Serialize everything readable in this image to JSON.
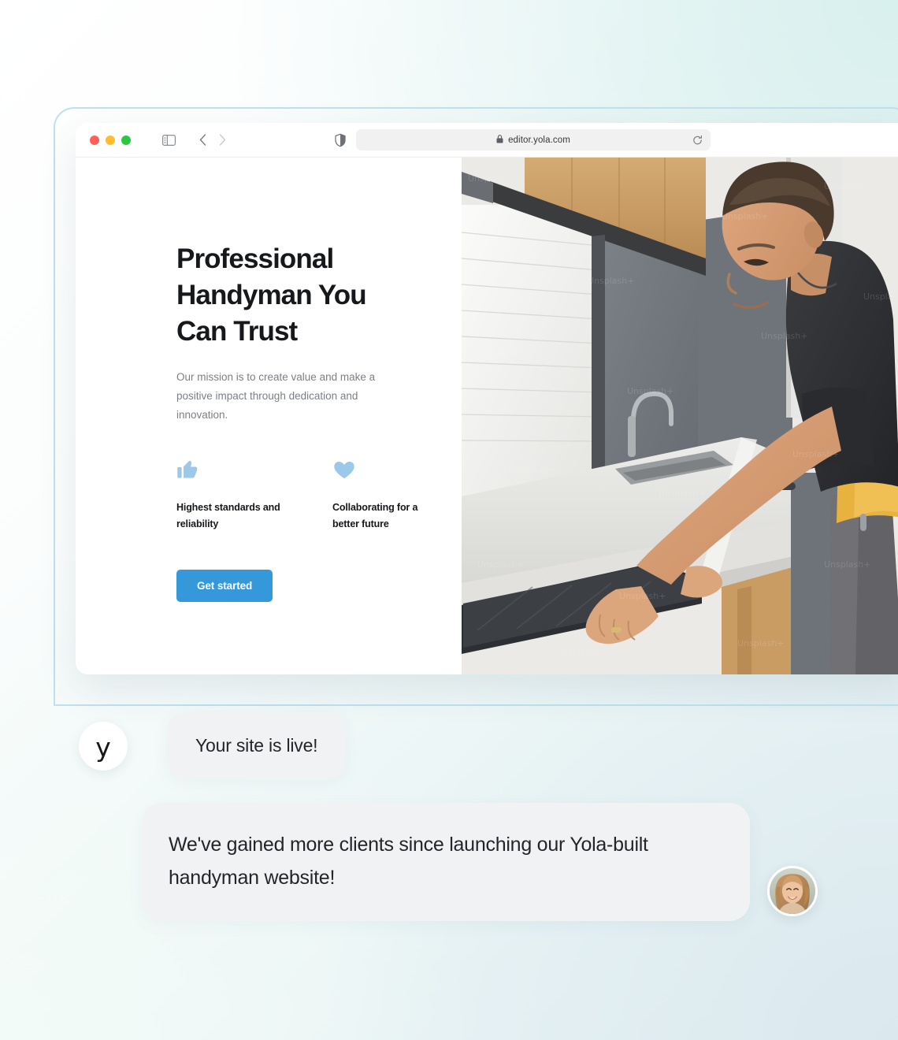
{
  "browser": {
    "traffic_lights": [
      {
        "name": "close",
        "color": "#ff5f57"
      },
      {
        "name": "minimize",
        "color": "#febc2e"
      },
      {
        "name": "maximize",
        "color": "#28c840"
      }
    ],
    "sidebar_toggle_icon": "sidebar-icon",
    "back_icon": "chevron-left-icon",
    "forward_icon": "chevron-right-icon",
    "shield_icon": "shield-icon",
    "lock_icon": "lock-icon",
    "reload_icon": "reload-icon",
    "url": "editor.yola.com"
  },
  "hero": {
    "heading": "Professional Handyman You Can Trust",
    "subtext": "Our mission is to create value and make a positive impact through dedication and innovation.",
    "features": [
      {
        "icon": "thumbs-up-icon",
        "label": "Highest standards and reliability",
        "color": "#9cc9ea"
      },
      {
        "icon": "heart-icon",
        "label": "Collaborating for a better future",
        "color": "#9cc9ea"
      }
    ],
    "cta_label": "Get started",
    "cta_color": "#3498db",
    "photo_alt": "handyman installing a cooktop in a kitchen"
  },
  "chat": {
    "yola_logo": "y",
    "messages": [
      {
        "from": "yola",
        "text": "Your site is live!"
      },
      {
        "from": "client",
        "text": "We've gained more clients since launching our Yola-built handyman website!"
      }
    ],
    "client_avatar": "smiling-woman-avatar"
  },
  "colors": {
    "accent": "#3498db",
    "icon_light_blue": "#9cc9ea",
    "bubble_bg": "#f1f2f3",
    "frame_outline": "#bfe0ee",
    "heading": "#16181c",
    "body_text": "#7b7f86"
  }
}
